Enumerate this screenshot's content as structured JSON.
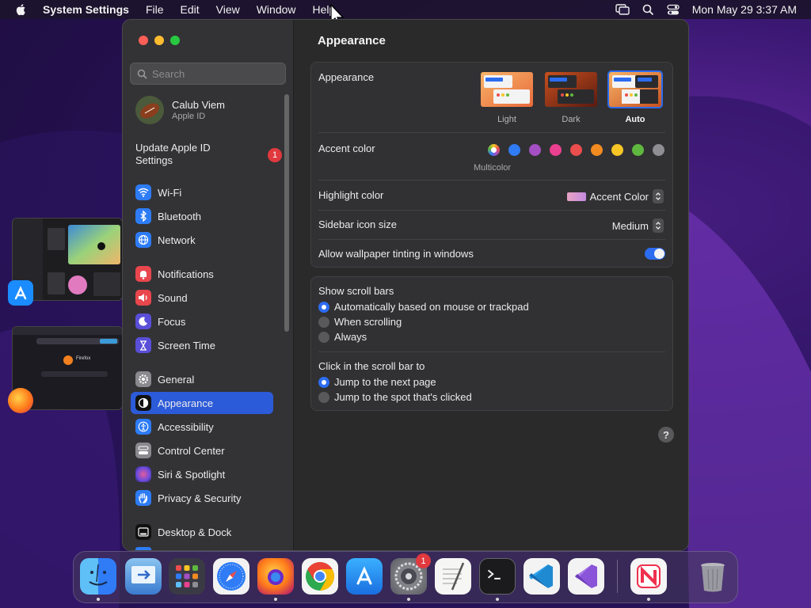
{
  "menubar": {
    "app_name": "System Settings",
    "items": [
      "File",
      "Edit",
      "View",
      "Window",
      "Help"
    ],
    "clock": "Mon May 29  3:37 AM"
  },
  "window": {
    "search": {
      "placeholder": "Search",
      "value": ""
    },
    "profile": {
      "name": "Calub Viem",
      "subtitle": "Apple ID"
    },
    "update": {
      "label": "Update Apple ID Settings",
      "badge": "1"
    },
    "sidebar": {
      "items": [
        {
          "label": "Wi-Fi",
          "icon": "wifi-icon",
          "color": "#2d7cf6"
        },
        {
          "label": "Bluetooth",
          "icon": "bluetooth-icon",
          "color": "#2d7cf6"
        },
        {
          "label": "Network",
          "icon": "globe-icon",
          "color": "#2d7cf6"
        },
        {
          "label": "Notifications",
          "icon": "bell-icon",
          "color": "#e8474d"
        },
        {
          "label": "Sound",
          "icon": "speaker-icon",
          "color": "#e8474d"
        },
        {
          "label": "Focus",
          "icon": "moon-icon",
          "color": "#5a4fd8"
        },
        {
          "label": "Screen Time",
          "icon": "hourglass-icon",
          "color": "#5a4fd8"
        },
        {
          "label": "General",
          "icon": "gear-icon",
          "color": "#8a8a8e"
        },
        {
          "label": "Appearance",
          "icon": "appearance-icon",
          "color": "#111111"
        },
        {
          "label": "Accessibility",
          "icon": "accessibility-icon",
          "color": "#2d7cf6"
        },
        {
          "label": "Control Center",
          "icon": "control-center-icon",
          "color": "#8a8a8e"
        },
        {
          "label": "Siri & Spotlight",
          "icon": "siri-icon",
          "color": "#7a5ce0"
        },
        {
          "label": "Privacy & Security",
          "icon": "hand-icon",
          "color": "#2d7cf6"
        },
        {
          "label": "Desktop & Dock",
          "icon": "dock-icon",
          "color": "#111111"
        }
      ],
      "selected": "Appearance"
    },
    "main": {
      "title": "Appearance",
      "appearance": {
        "label": "Appearance",
        "options": [
          "Light",
          "Dark",
          "Auto"
        ],
        "selected": "Auto"
      },
      "accent": {
        "label": "Accent color",
        "multicolor_label": "Multicolor",
        "colors": [
          "#2f7cf6",
          "#a54fc4",
          "#e9418f",
          "#ec4d4d",
          "#f28b20",
          "#f8c625",
          "#5fb83f",
          "#8e8e93"
        ]
      },
      "highlight": {
        "label": "Highlight color",
        "value": "Accent Color"
      },
      "sidebar_icon_size": {
        "label": "Sidebar icon size",
        "value": "Medium"
      },
      "wallpaper_tinting": {
        "label": "Allow wallpaper tinting in windows",
        "enabled": true
      },
      "scroll_bars": {
        "label": "Show scroll bars",
        "options": [
          "Automatically based on mouse or trackpad",
          "When scrolling",
          "Always"
        ],
        "selected": "Automatically based on mouse or trackpad"
      },
      "click_scroll": {
        "label": "Click in the scroll bar to",
        "options": [
          "Jump to the next page",
          "Jump to the spot that's clicked"
        ],
        "selected": "Jump to the next page"
      },
      "help": "?"
    }
  },
  "dock": {
    "apps": [
      "Finder",
      "Migration Assistant",
      "Launchpad",
      "Safari",
      "Firefox",
      "Chrome",
      "App Store",
      "System Settings",
      "TextEdit",
      "Terminal",
      "VS Code",
      "Visual Studio",
      "News",
      "Trash"
    ],
    "settings_badge": "1"
  },
  "thumbnails": {
    "firefox_caption": "Firefox"
  }
}
